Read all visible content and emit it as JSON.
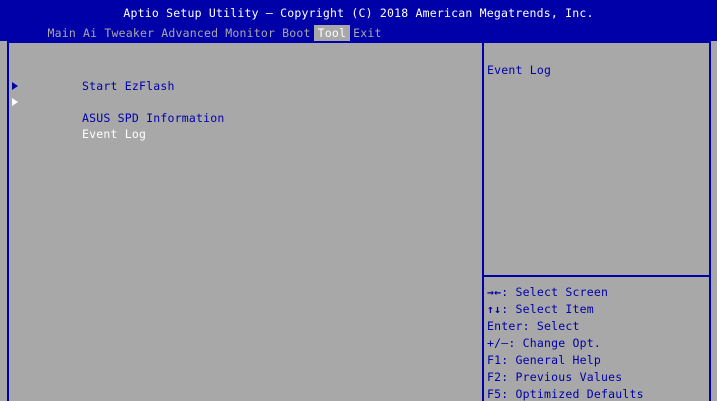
{
  "header": {
    "title": "Aptio Setup Utility – Copyright (C) 2018 American Megatrends, Inc.",
    "tabs": [
      {
        "label": "Main",
        "active": false
      },
      {
        "label": "Ai Tweaker",
        "active": false
      },
      {
        "label": "Advanced",
        "active": false
      },
      {
        "label": "Monitor",
        "active": false
      },
      {
        "label": "Boot",
        "active": false
      },
      {
        "label": "Tool",
        "active": true
      },
      {
        "label": "Exit",
        "active": false
      }
    ]
  },
  "items": [
    {
      "label": "Start EzFlash",
      "submenu": false,
      "selected": false
    },
    {
      "label": "ASUS SPD Information",
      "submenu": true,
      "selected": false
    },
    {
      "label": "Event Log",
      "submenu": true,
      "selected": true
    }
  ],
  "help": {
    "description": "Event Log"
  },
  "keys": [
    {
      "key": "→←",
      "desc": ": Select Screen"
    },
    {
      "key": "↑↓",
      "desc": ": Select Item"
    },
    {
      "key": "Enter",
      "desc": ": Select"
    },
    {
      "key": "+/–",
      "desc": ": Change Opt."
    },
    {
      "key": "F1",
      "desc": ": General Help"
    },
    {
      "key": "F2",
      "desc": ": Previous Values"
    },
    {
      "key": "F5",
      "desc": ": Optimized Defaults"
    }
  ],
  "colors": {
    "background": "#a8a8a8",
    "accent": "#0000a8",
    "highlight": "#ffffff"
  }
}
